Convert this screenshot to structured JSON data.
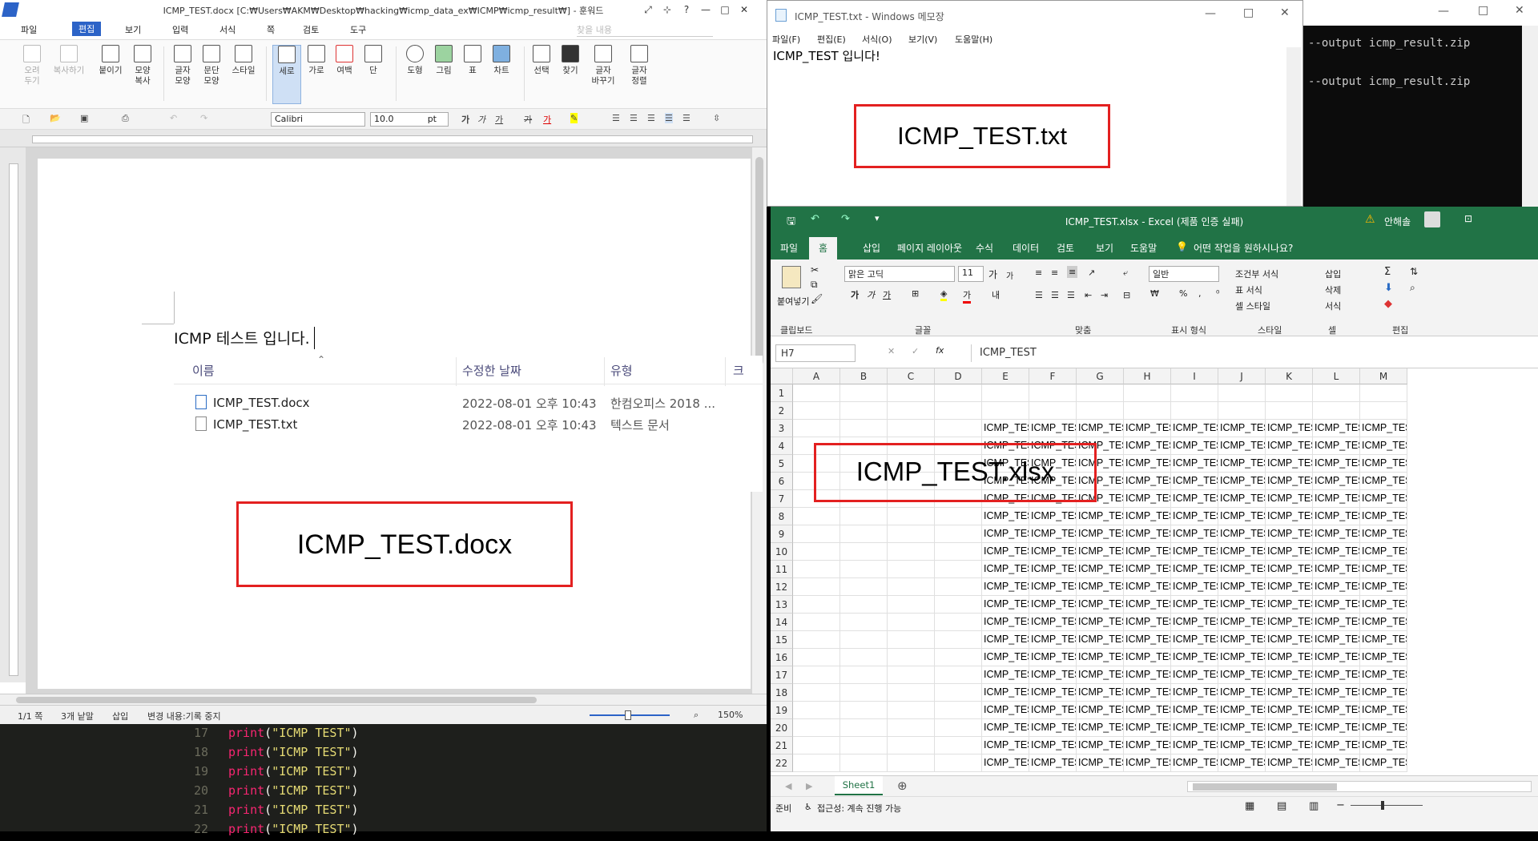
{
  "hwp": {
    "title": "ICMP_TEST.docx [C:₩Users₩AKM₩Desktop₩hacking₩icmp_data_ex₩ICMP₩icmp_result₩] - 훈워드",
    "menus": [
      "파일",
      "편집",
      "보기",
      "입력",
      "서식",
      "쪽",
      "검토",
      "도구"
    ],
    "search_placeholder": "찾을 내용",
    "ribbon": [
      {
        "label": "오려\n두기",
        "icon": "scissors-icon",
        "dim": true
      },
      {
        "label": "복사하기",
        "icon": "copy-icon",
        "dim": true
      },
      {
        "label": "붙이기",
        "icon": "paste-icon"
      },
      {
        "label": "모양\n복사",
        "icon": "format-painter-icon"
      },
      {
        "label": "글자\n모양",
        "icon": "char-format-icon"
      },
      {
        "label": "문단\n모양",
        "icon": "para-format-icon"
      },
      {
        "label": "스타일",
        "icon": "style-icon"
      },
      {
        "label": "세로",
        "icon": "portrait-icon",
        "selected": true
      },
      {
        "label": "가로",
        "icon": "landscape-icon"
      },
      {
        "label": "여백",
        "icon": "margin-icon"
      },
      {
        "label": "단",
        "icon": "columns-icon"
      },
      {
        "label": "도형",
        "icon": "shape-icon"
      },
      {
        "label": "그림",
        "icon": "picture-icon"
      },
      {
        "label": "표",
        "icon": "table-icon"
      },
      {
        "label": "차트",
        "icon": "chart-icon"
      },
      {
        "label": "선택",
        "icon": "select-icon"
      },
      {
        "label": "찾기",
        "icon": "binoculars-icon"
      },
      {
        "label": "글자\n바꾸기",
        "icon": "replace-icon"
      },
      {
        "label": "글자\n정렬",
        "icon": "sort-icon"
      }
    ],
    "font": "Calibri",
    "font_size": "10.0",
    "font_unit": "pt",
    "doc_text": "ICMP 테스트 입니다.",
    "status": {
      "page": "1/1 쪽",
      "words": "3개 낱말",
      "mode": "삽입",
      "track": "변경 내용:기록 중지",
      "zoom": "150%"
    }
  },
  "explorer": {
    "headers": {
      "name": "이름",
      "date": "수정한 날짜",
      "type": "유형",
      "size": "크"
    },
    "files": [
      {
        "name": "ICMP_TEST.docx",
        "date": "2022-08-01 오후 10:43",
        "type": "한컴오피스 2018 ..."
      },
      {
        "name": "ICMP_TEST.txt",
        "date": "2022-08-01 오후 10:43",
        "type": "텍스트 문서"
      }
    ]
  },
  "labels": {
    "docx": "ICMP_TEST.docx",
    "txt": "ICMP_TEST.txt",
    "xlsx": "ICMP_TEST.xlsx"
  },
  "code": {
    "lines": [
      {
        "num": "17",
        "fn": "print",
        "arg": "\"ICMP TEST\""
      },
      {
        "num": "18",
        "fn": "print",
        "arg": "\"ICMP TEST\""
      },
      {
        "num": "19",
        "fn": "print",
        "arg": "\"ICMP TEST\""
      },
      {
        "num": "20",
        "fn": "print",
        "arg": "\"ICMP TEST\""
      },
      {
        "num": "21",
        "fn": "print",
        "arg": "\"ICMP TEST\""
      },
      {
        "num": "22",
        "fn": "print",
        "arg": "\"ICMP TEST\""
      }
    ]
  },
  "notepad": {
    "title": "ICMP_TEST.txt - Windows 메모장",
    "menus": [
      "파일(F)",
      "편집(E)",
      "서식(O)",
      "보기(V)",
      "도움말(H)"
    ],
    "content": "ICMP_TEST 입니다!"
  },
  "terminal": {
    "lines": [
      "--output icmp_result.zip",
      "--output icmp_result.zip"
    ]
  },
  "excel": {
    "title": "ICMP_TEST.xlsx  -  Excel (제품 인증 실패)",
    "user": "안해솔",
    "tabs": [
      "파일",
      "홈",
      "삽입",
      "페이지 레이아웃",
      "수식",
      "데이터",
      "검토",
      "보기",
      "도움말"
    ],
    "tell_me": "어떤 작업을 원하시나요?",
    "font": "맑은 고딕",
    "font_size": "11",
    "number_format": "일반",
    "groups": [
      "클립보드",
      "글꼴",
      "맞춤",
      "표시 형식",
      "스타일",
      "셀",
      "편집"
    ],
    "ribbon_items": {
      "paste": "붙여넣기",
      "cond": "조건부 서식",
      "table": "표 서식",
      "cellstyle": "셀 스타일",
      "insert": "삽입",
      "delete": "삭제",
      "format": "서식"
    },
    "name_box": "H7",
    "formula": "ICMP_TEST",
    "columns": [
      "A",
      "B",
      "C",
      "D",
      "E",
      "F",
      "G",
      "H",
      "I",
      "J",
      "K",
      "L",
      "M"
    ],
    "rows": [
      "1",
      "2",
      "3",
      "4",
      "5",
      "6",
      "7",
      "8",
      "9",
      "10",
      "11",
      "12",
      "13",
      "14",
      "15",
      "16",
      "17",
      "18",
      "19",
      "20",
      "21",
      "22"
    ],
    "cell_value": "ICMP_TEST",
    "data_start_row": 3,
    "data_start_col": 4,
    "sheet": "Sheet1",
    "status_ready": "준비",
    "accessibility": "접근성: 계속 진행 가능"
  }
}
